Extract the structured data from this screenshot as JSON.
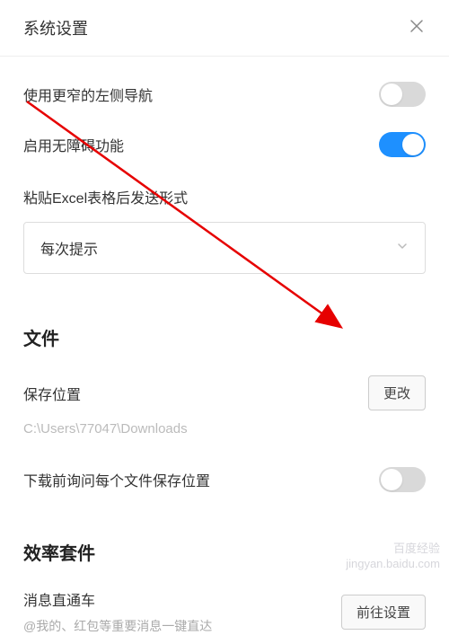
{
  "header": {
    "title": "系统设置"
  },
  "settings": {
    "narrow_sidebar_label": "使用更窄的左侧导航",
    "accessibility_label": "启用无障碍功能",
    "paste_excel_label": "粘贴Excel表格后发送形式",
    "paste_excel_value": "每次提示"
  },
  "file_section": {
    "title": "文件",
    "save_location_label": "保存位置",
    "change_btn": "更改",
    "save_path": "C:\\Users\\77047\\Downloads",
    "ask_before_download_label": "下载前询问每个文件保存位置"
  },
  "efficiency_section": {
    "title": "效率套件",
    "express_label": "消息直通车",
    "express_desc": "@我的、红包等重要消息一键直达",
    "goto_btn": "前往设置"
  },
  "watermark": {
    "line1": "百度经验",
    "line2": "jingyan.baidu.com"
  }
}
